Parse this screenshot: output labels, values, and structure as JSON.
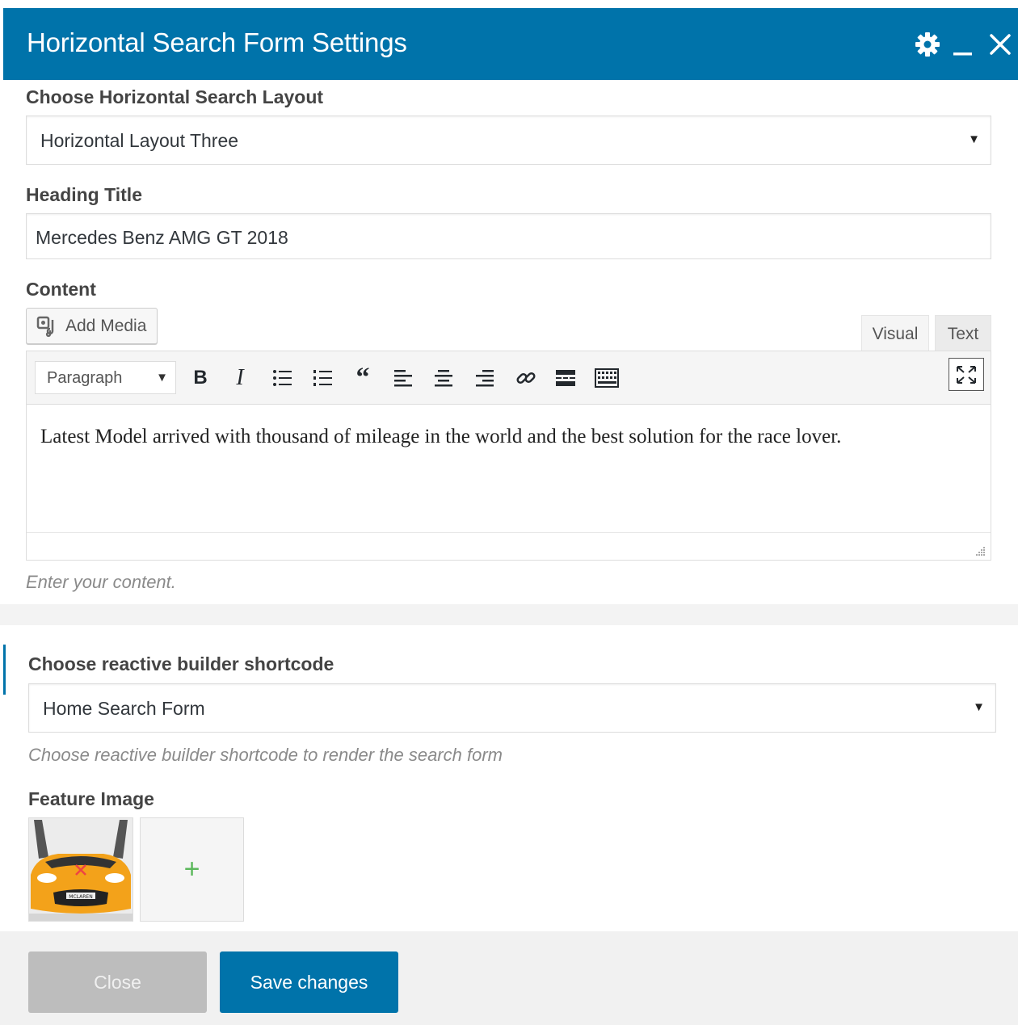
{
  "dialog": {
    "title": "Horizontal Search Form Settings",
    "icons": [
      "gear-icon",
      "minimize-icon",
      "close-icon"
    ]
  },
  "layout_field": {
    "label": "Choose Horizontal Search Layout",
    "value": "Horizontal Layout Three"
  },
  "heading_field": {
    "label": "Heading Title",
    "value": "Mercedes Benz AMG GT 2018"
  },
  "content_field": {
    "label": "Content",
    "add_media_label": "Add Media",
    "tabs": {
      "visual": "Visual",
      "text": "Text"
    },
    "format_value": "Paragraph",
    "body_text": "Latest Model arrived with thousand of mileage in the world and the best solution for the race lover.",
    "help": "Enter your content."
  },
  "shortcode_field": {
    "label": "Choose reactive builder shortcode",
    "value": "Home Search Form",
    "help": "Choose reactive builder shortcode to render the search form"
  },
  "feature_image": {
    "label": "Feature Image",
    "add_symbol": "+",
    "plate_text": "MCLAREN"
  },
  "footer": {
    "close_label": "Close",
    "save_label": "Save changes"
  },
  "colors": {
    "header_bg": "#0073aa",
    "primary_button": "#0073aa",
    "disabled_button": "#bdbdbd",
    "add_plus": "#5cb85c"
  }
}
